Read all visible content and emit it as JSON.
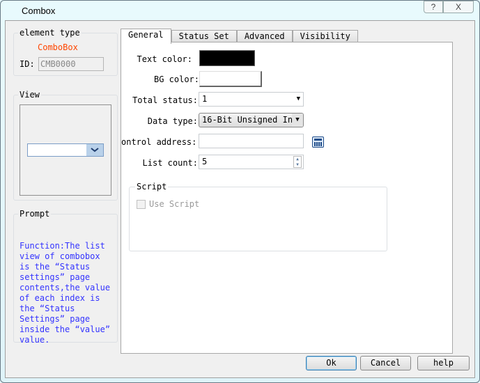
{
  "window": {
    "title": "Combox",
    "help_label": "?",
    "close_label": "X"
  },
  "element_type": {
    "group_label": "element type",
    "type_name": "ComboBox",
    "id_label": "ID:",
    "id_value": "CMB0000"
  },
  "view": {
    "group_label": "View"
  },
  "prompt": {
    "group_label": "Prompt",
    "lines": [
      "Function:The list",
      "view of combobox",
      "is the “Status",
      "settings” page",
      "contents,the value",
      "of each index is",
      "the “Status",
      "Settings” page",
      "inside the “value”",
      "value."
    ]
  },
  "tabs": [
    {
      "label": "General"
    },
    {
      "label": "Status Set"
    },
    {
      "label": "Advanced"
    },
    {
      "label": "Visibility"
    }
  ],
  "general": {
    "text_color_label": "Text color:",
    "text_color": "#000000",
    "bg_color_label": "BG color:",
    "bg_color": "#ffffff",
    "total_status_label": "Total status:",
    "total_status_value": "1",
    "data_type_label": "Data type:",
    "data_type_value": "16-Bit Unsigned In",
    "control_address_label": "ontrol address:",
    "control_address_value": "",
    "list_count_label": "List count:",
    "list_count_value": "5",
    "script_group_label": "Script",
    "use_script_label": "Use Script",
    "use_script_checked": false
  },
  "buttons": {
    "ok": "Ok",
    "cancel": "Cancel",
    "help": "help"
  },
  "colors": {
    "type_name": "#ff4500",
    "prompt_text": "#3333ff",
    "dropdown_button": "#b9d1ea"
  }
}
